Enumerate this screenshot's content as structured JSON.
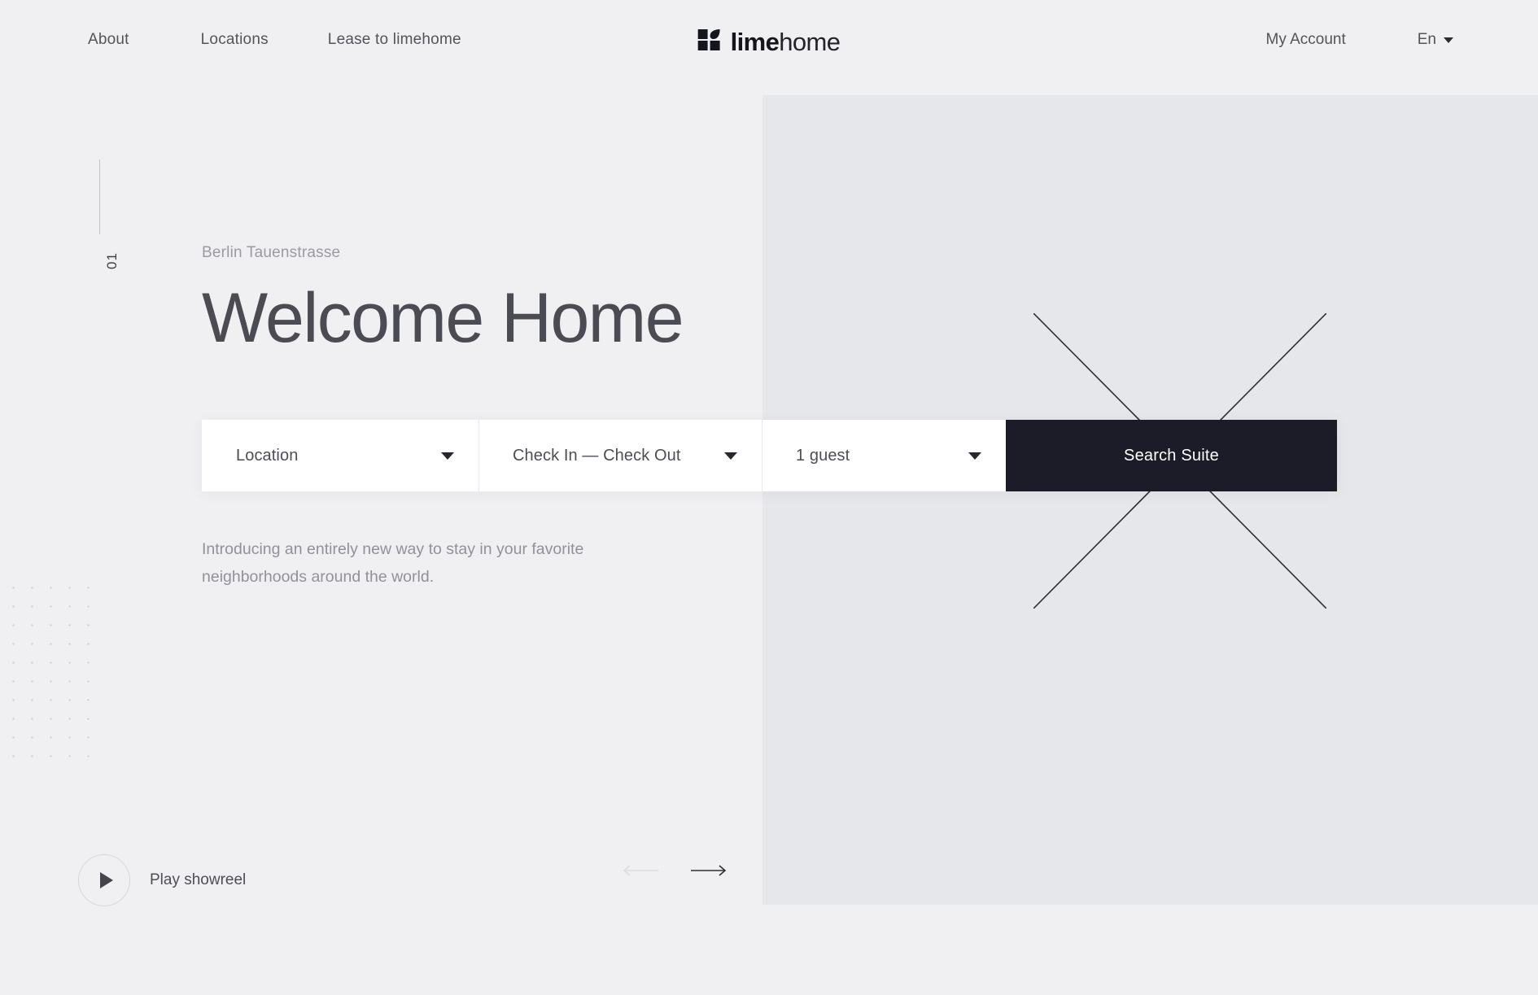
{
  "brand": {
    "name_bold": "lime",
    "name_light": "home",
    "logo_icon": "limehome-squares-leaf-logo"
  },
  "header": {
    "nav_links": [
      {
        "label": "About"
      },
      {
        "label": "Locations"
      },
      {
        "label": "Lease to limehome"
      }
    ],
    "account_label": "My Account",
    "language": {
      "label": "En",
      "caret_icon": "chevron-down-icon"
    }
  },
  "hero": {
    "slide_index": "01",
    "eyebrow": "Berlin Tauenstrasse",
    "title": "Welcome Home",
    "intro": "Introducing an entirely new way to stay in your favorite neighborhoods around the world."
  },
  "search": {
    "location": {
      "value": "Location",
      "caret_icon": "chevron-down-icon"
    },
    "dates": {
      "value": "Check In — Check Out",
      "caret_icon": "chevron-down-icon"
    },
    "guests": {
      "value": "1 guest",
      "caret_icon": "chevron-down-icon"
    },
    "submit_label": "Search Suite"
  },
  "footer": {
    "showreel_label": "Play showreel",
    "play_icon": "play-triangle-icon",
    "prev_icon": "arrow-left-icon",
    "next_icon": "arrow-right-icon"
  },
  "colors": {
    "page_background": "#f0f0f3",
    "panel_background": "#e6e7eb",
    "accent_dark": "#1b1c28",
    "text_primary": "#4a4a52",
    "text_muted": "#91919c"
  }
}
